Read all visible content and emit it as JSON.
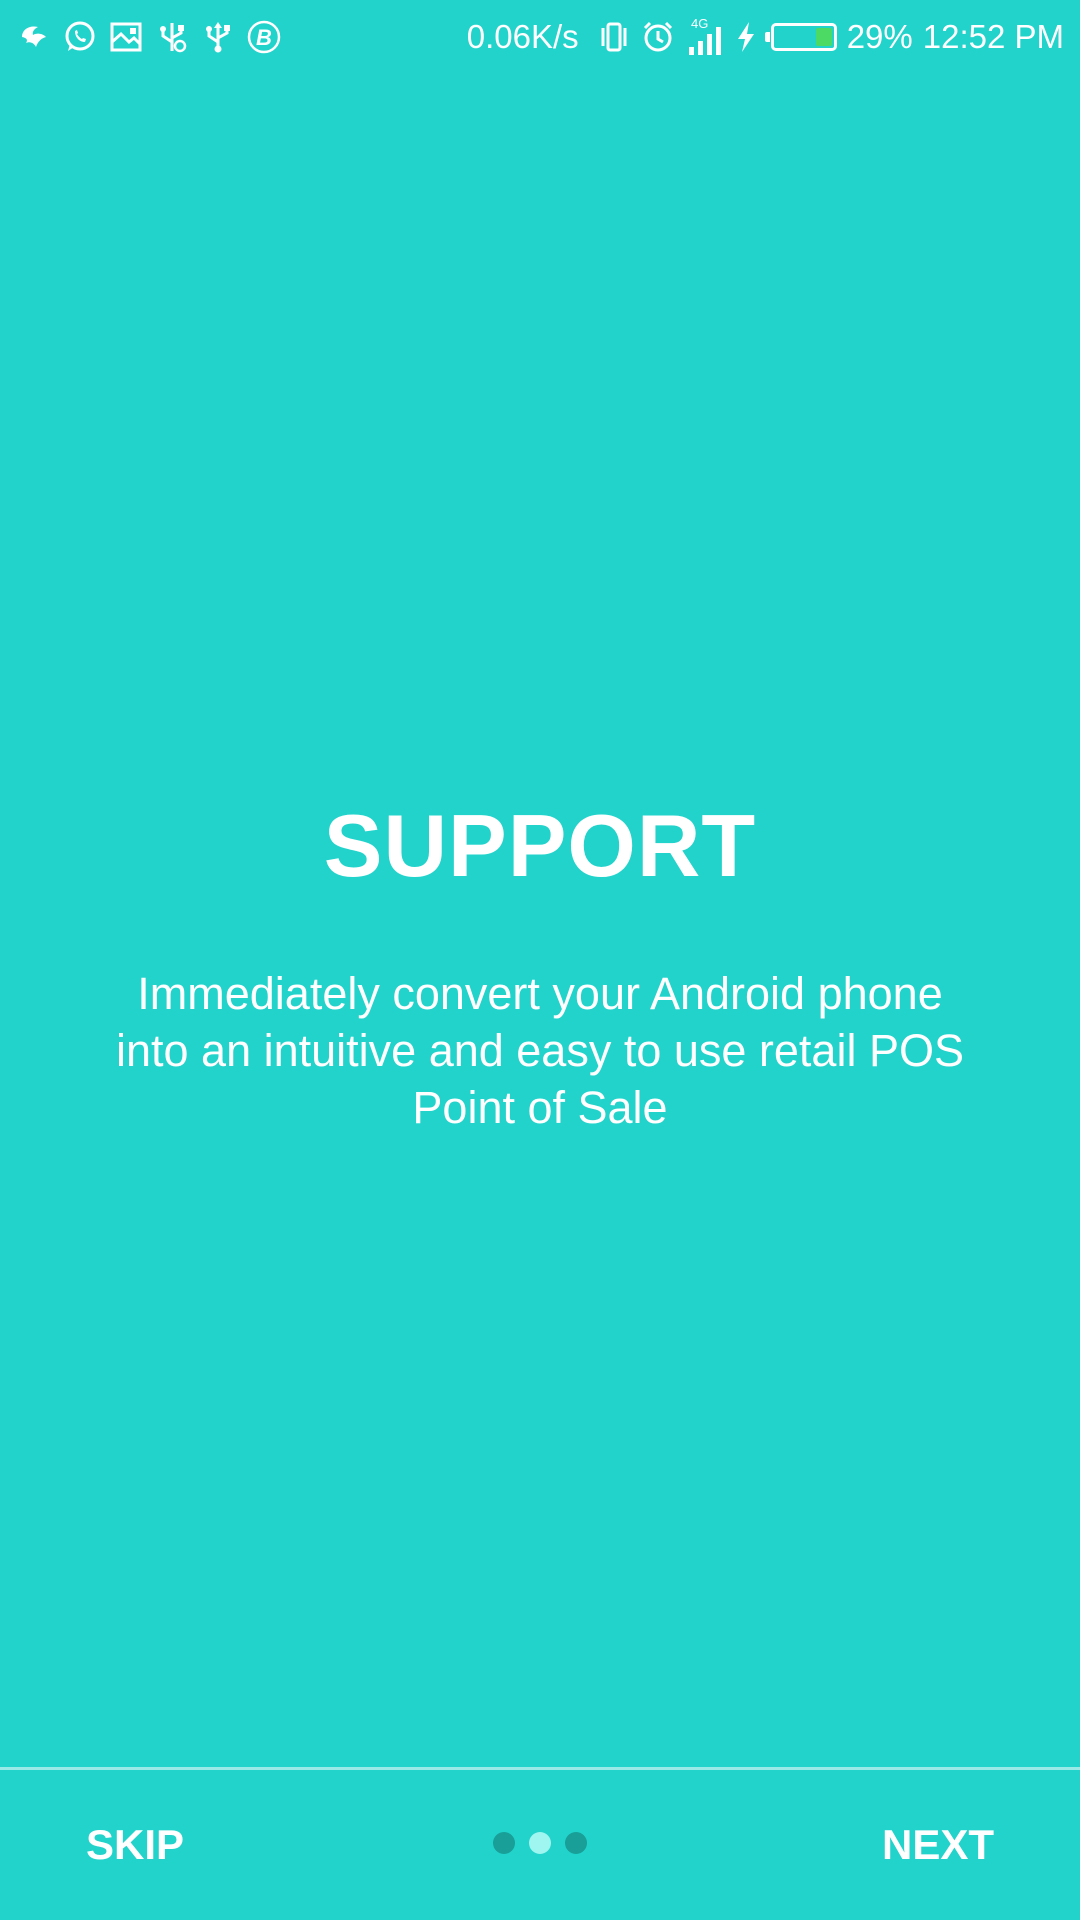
{
  "status_bar": {
    "left_icons": [
      "bird-app-icon",
      "whatsapp-icon",
      "image-icon",
      "usb-debug-icon",
      "usb-icon",
      "b-circle-icon"
    ],
    "net_speed": "0.06K/s",
    "network_type": "4G",
    "battery_percent": "29%",
    "battery_level": 0.29,
    "time": "12:52 PM"
  },
  "onboarding": {
    "title": "SUPPORT",
    "description": "Immediately convert your Android phone into an intuitive and easy to use retail POS Point of Sale"
  },
  "footer": {
    "skip_label": "SKIP",
    "next_label": "NEXT",
    "page_count": 3,
    "active_page": 2
  },
  "colors": {
    "background": "#21d3cb",
    "dot_inactive": "#199e98",
    "dot_active": "#9ff5ef",
    "battery_fill": "#4cd964"
  }
}
